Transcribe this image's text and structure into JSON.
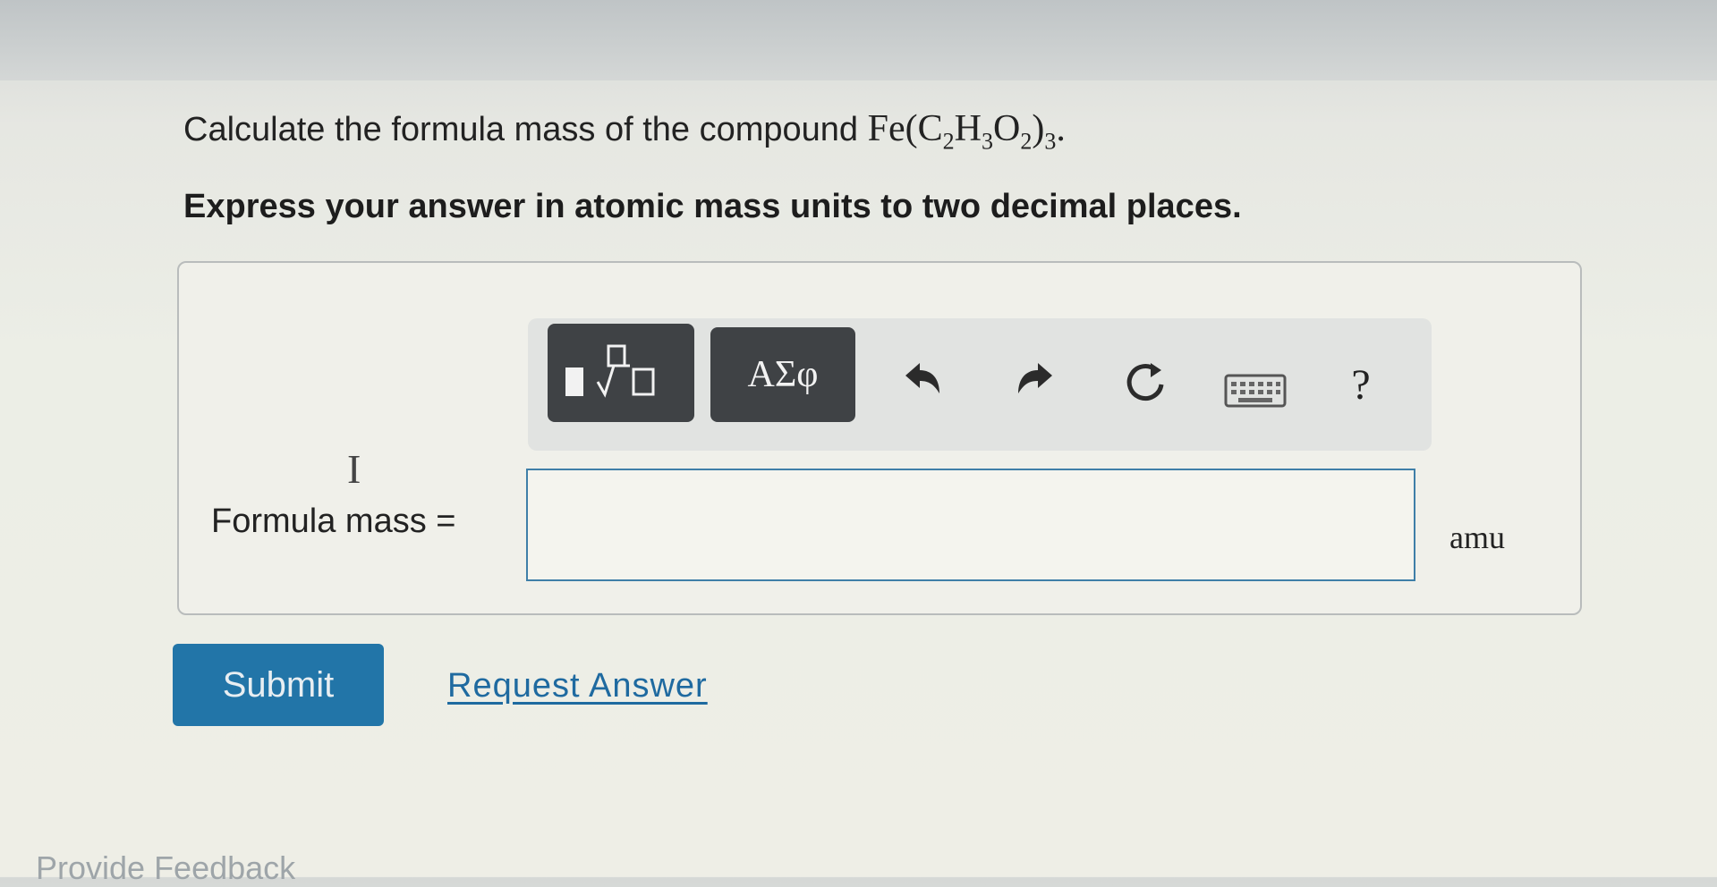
{
  "question": {
    "prefix": "Calculate the formula mass of the compound ",
    "formula": {
      "fe": "Fe(",
      "c": "C",
      "c_sub": "2",
      "h": "H",
      "h_sub": "3",
      "o": "O",
      "o_sub": "2",
      "close": ")",
      "outer_sub": "3",
      "period": "."
    },
    "instruction": "Express your answer in atomic mass units to two decimal places."
  },
  "toolbar": {
    "templates_icon": "templates-sqrt-icon",
    "greek_label": "ΑΣφ",
    "undo_icon": "undo-icon",
    "redo_icon": "redo-icon",
    "reset_icon": "reset-icon",
    "keyboard_icon": "keyboard-icon",
    "help_label": "?"
  },
  "answer": {
    "label": "Formula mass =",
    "value": "",
    "unit": "amu"
  },
  "actions": {
    "submit_label": "Submit",
    "request_answer_label": "Request Answer"
  },
  "footer": {
    "feedback_label": "Provide Feedback"
  }
}
